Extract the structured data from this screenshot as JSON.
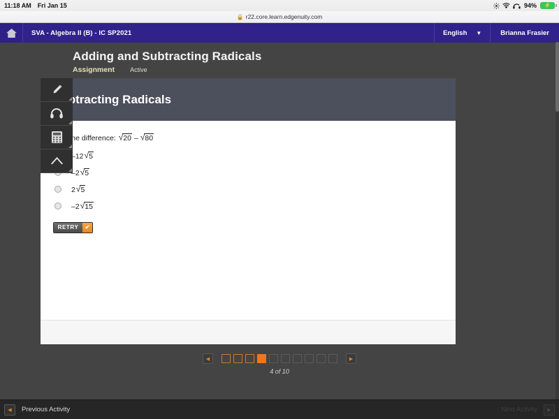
{
  "status_bar": {
    "time": "11:18 AM",
    "date": "Fri Jan 15",
    "battery_percent": "94%",
    "icons": [
      "brightness-icon",
      "wifi-icon",
      "headphones-icon",
      "battery-charging-icon"
    ]
  },
  "browser": {
    "url": "r22.core.learn.edgenuity.com",
    "lock_icon": "lock-icon"
  },
  "app_nav": {
    "home_icon": "home-icon",
    "course": "SVA - Algebra II (B) - IC SP2021",
    "language": "English",
    "language_chevron": "chevron-down-icon",
    "user": "Brianna Frasier",
    "background_color": "#30228a"
  },
  "lesson": {
    "title": "Adding and Subtracting Radicals",
    "type": "Assignment",
    "state": "Active"
  },
  "tools": [
    {
      "name": "highlighter-icon",
      "label": "Highlighter"
    },
    {
      "name": "headphones-icon",
      "label": "Text to Speech"
    },
    {
      "name": "calculator-icon",
      "label": "Calculator"
    },
    {
      "name": "collapse-up-icon",
      "label": "Collapse"
    }
  ],
  "question": {
    "header": "Subtracting Radicals",
    "prompt": "Find the difference:",
    "expression": {
      "term1_radicand": "20",
      "operator": "–",
      "term2_radicand": "80"
    },
    "options": [
      {
        "coefficient": "–12",
        "radicand": "5",
        "state": "incorrect",
        "mark": "wrong-x-icon"
      },
      {
        "coefficient": "–2",
        "radicand": "5",
        "state": "unselected",
        "mark": "radio-icon"
      },
      {
        "coefficient": "2",
        "radicand": "5",
        "state": "unselected",
        "mark": "radio-icon"
      },
      {
        "coefficient": "–2",
        "radicand": "15",
        "state": "unselected",
        "mark": "radio-icon"
      }
    ],
    "retry": {
      "label": "RETRY",
      "check_icon": "check-icon",
      "accent_color": "#ef8b1f"
    },
    "header_color": "#4c505c"
  },
  "pager": {
    "prev_icon": "triangle-left-icon",
    "next_icon": "triangle-right-icon",
    "total": 10,
    "current": 4,
    "seen": 3,
    "count_label": "4 of 10",
    "accent_color": "#ef7521"
  },
  "bottom_bar": {
    "previous": {
      "label": "Previous Activity",
      "icon": "triangle-left-icon",
      "enabled": true
    },
    "next": {
      "label": "Next Activity",
      "icon": "triangle-right-icon",
      "enabled": false
    }
  }
}
